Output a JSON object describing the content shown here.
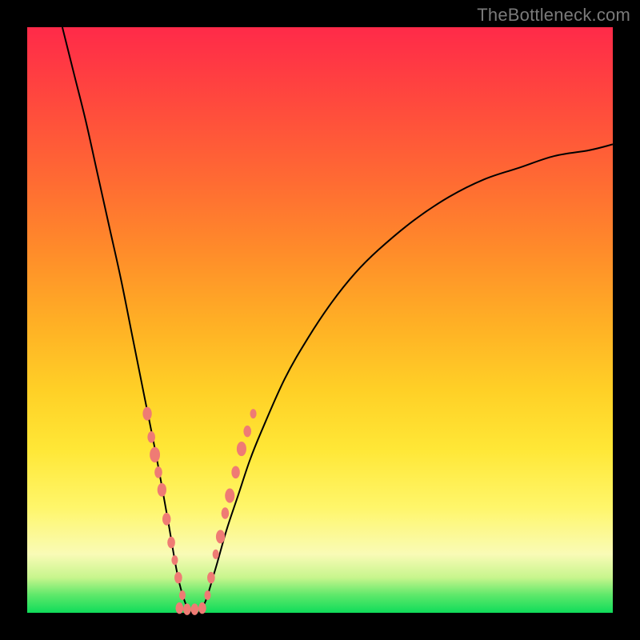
{
  "watermark": "TheBottleneck.com",
  "colors": {
    "background": "#000000",
    "gradient_top": "#ff2a49",
    "gradient_bottom": "#0fdc5a",
    "curve": "#000000",
    "marker": "#ef7b74"
  },
  "chart_data": {
    "type": "line",
    "title": "",
    "xlabel": "",
    "ylabel": "",
    "xlim": [
      0,
      100
    ],
    "ylim": [
      0,
      100
    ],
    "notes": "V-shaped bottleneck curve. Y≈100 means severe bottleneck (red zone), Y≈0 means balanced (green zone). Minimum (Y≈0) occurs around X≈26–30. Left branch ascends very steeply toward top-left; right branch rises and tapers off toward upper-right around Y≈80 at X≈100. Values are estimated from the image (no axis ticks present).",
    "series": [
      {
        "name": "bottleneck-curve",
        "x": [
          6,
          8,
          10,
          12,
          14,
          16,
          18,
          20,
          22,
          24,
          26,
          28,
          30,
          32,
          34,
          36,
          38,
          40,
          44,
          48,
          52,
          56,
          60,
          66,
          72,
          78,
          84,
          90,
          96,
          100
        ],
        "values": [
          100,
          92,
          84,
          75,
          66,
          57,
          47,
          37,
          27,
          16,
          5,
          0,
          1,
          7,
          14,
          20,
          26,
          31,
          40,
          47,
          53,
          58,
          62,
          67,
          71,
          74,
          76,
          78,
          79,
          80
        ]
      }
    ],
    "markers": {
      "name": "highlighted-points",
      "comment": "Salmon-colored rounded markers clustered on the lower part of both branches, with a short horizontal run across the trough.",
      "points": [
        {
          "x": 20.5,
          "y": 34,
          "r": 1.4
        },
        {
          "x": 21.2,
          "y": 30,
          "r": 1.2
        },
        {
          "x": 21.8,
          "y": 27,
          "r": 1.6
        },
        {
          "x": 22.4,
          "y": 24,
          "r": 1.2
        },
        {
          "x": 23.0,
          "y": 21,
          "r": 1.4
        },
        {
          "x": 23.8,
          "y": 16,
          "r": 1.3
        },
        {
          "x": 24.6,
          "y": 12,
          "r": 1.2
        },
        {
          "x": 25.2,
          "y": 9,
          "r": 1.0
        },
        {
          "x": 25.8,
          "y": 6,
          "r": 1.2
        },
        {
          "x": 26.5,
          "y": 3,
          "r": 1.0
        },
        {
          "x": 26.0,
          "y": 0.8,
          "r": 1.2
        },
        {
          "x": 27.3,
          "y": 0.6,
          "r": 1.2
        },
        {
          "x": 28.6,
          "y": 0.6,
          "r": 1.2
        },
        {
          "x": 29.9,
          "y": 0.8,
          "r": 1.2
        },
        {
          "x": 30.8,
          "y": 3,
          "r": 1.0
        },
        {
          "x": 31.4,
          "y": 6,
          "r": 1.2
        },
        {
          "x": 32.2,
          "y": 10,
          "r": 1.0
        },
        {
          "x": 33.0,
          "y": 13,
          "r": 1.4
        },
        {
          "x": 33.8,
          "y": 17,
          "r": 1.2
        },
        {
          "x": 34.6,
          "y": 20,
          "r": 1.5
        },
        {
          "x": 35.6,
          "y": 24,
          "r": 1.3
        },
        {
          "x": 36.6,
          "y": 28,
          "r": 1.5
        },
        {
          "x": 37.6,
          "y": 31,
          "r": 1.2
        },
        {
          "x": 38.6,
          "y": 34,
          "r": 1.0
        }
      ]
    }
  }
}
